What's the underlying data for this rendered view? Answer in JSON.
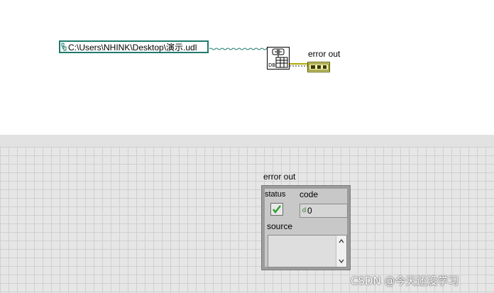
{
  "block_diagram": {
    "path_constant": "C:\\Users\\NHINK\\Desktop\\演示.udl",
    "subvi_label": "DB",
    "error_out_label": "error out"
  },
  "front_panel": {
    "cluster_label": "error out",
    "status_label": "status",
    "code_label": "code",
    "code_rep": "d",
    "code_value": "0",
    "source_label": "source",
    "source_value": ""
  },
  "watermark": "CSDN @今天还没学习",
  "colors": {
    "path_wire": "#1f7a6d",
    "error_wire": "#d4c800",
    "check_green": "#2e9e2e"
  }
}
